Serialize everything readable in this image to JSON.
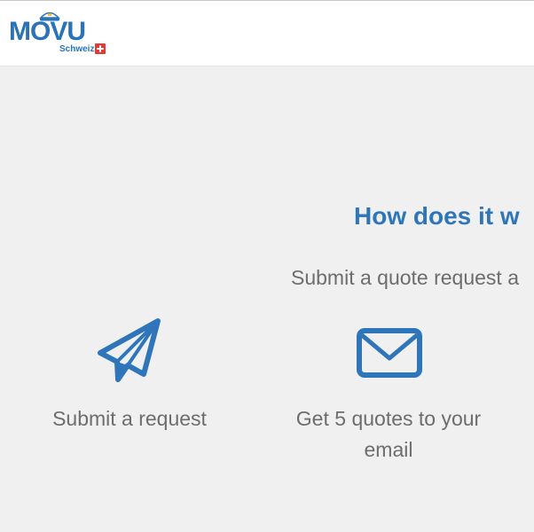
{
  "header": {
    "logo": {
      "word": "MOVU",
      "subtitle": "Schweiz",
      "brand_color": "#2a73b8",
      "flag_color": "#e53935"
    }
  },
  "main": {
    "title": "How does it w",
    "subtitle": "Submit a quote request a",
    "accent_color": "#2e76b9",
    "text_color": "#6d6d6d",
    "steps": [
      {
        "icon": "paper-plane-icon",
        "label": "Submit a request"
      },
      {
        "icon": "envelope-icon",
        "label": "Get 5 quotes to your email"
      }
    ]
  }
}
